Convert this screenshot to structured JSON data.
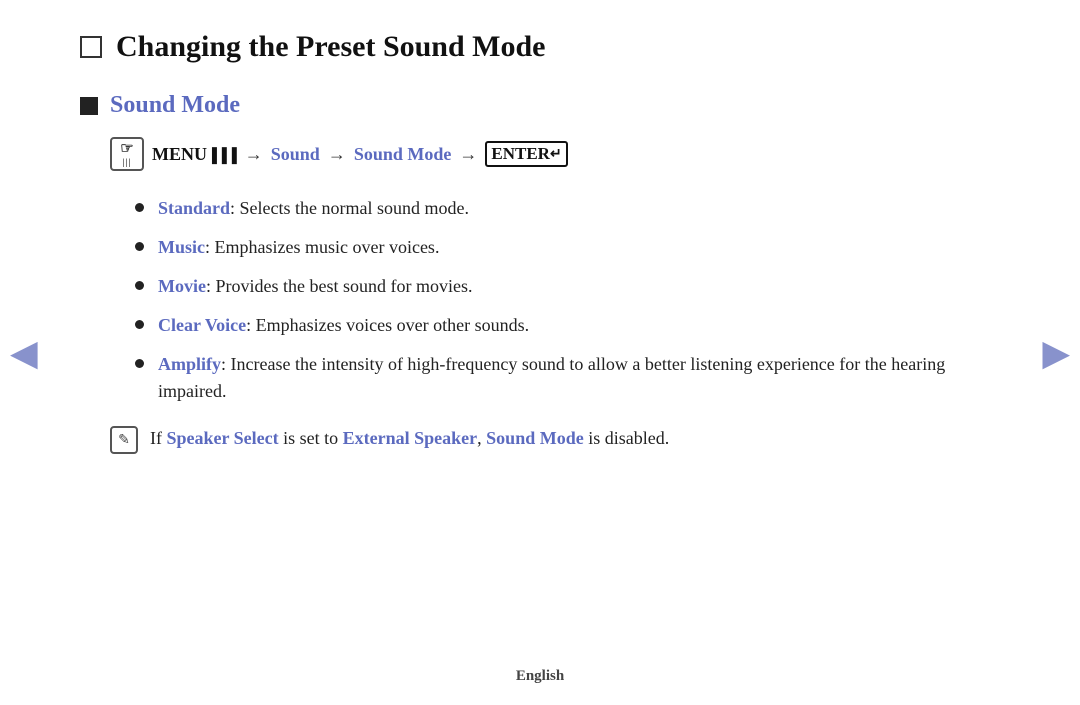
{
  "page": {
    "title": "Changing the Preset Sound Mode",
    "section": {
      "title": "Sound Mode",
      "menu_path": {
        "menu_label": "MENU",
        "arrow": "→",
        "sound_link": "Sound",
        "sound_mode_link": "Sound Mode",
        "enter_label": "ENTER"
      }
    },
    "bullets": [
      {
        "term": "Standard",
        "desc": ": Selects the normal sound mode."
      },
      {
        "term": "Music",
        "desc": ": Emphasizes music over voices."
      },
      {
        "term": "Movie",
        "desc": ": Provides the best sound for movies."
      },
      {
        "term": "Clear Voice",
        "desc": ": Emphasizes voices over other sounds."
      },
      {
        "term": "Amplify",
        "desc": ": Increase the intensity of high-frequency sound to allow a better listening experience for the hearing impaired."
      }
    ],
    "note": {
      "prefix": " If ",
      "speaker_select": "Speaker Select",
      "middle": " is set to ",
      "external_speaker": "External Speaker",
      "comma": ",",
      "sound_mode": " Sound Mode",
      "suffix": " is disabled."
    },
    "nav": {
      "left_arrow": "◀",
      "right_arrow": "▶"
    },
    "footer": "English"
  }
}
